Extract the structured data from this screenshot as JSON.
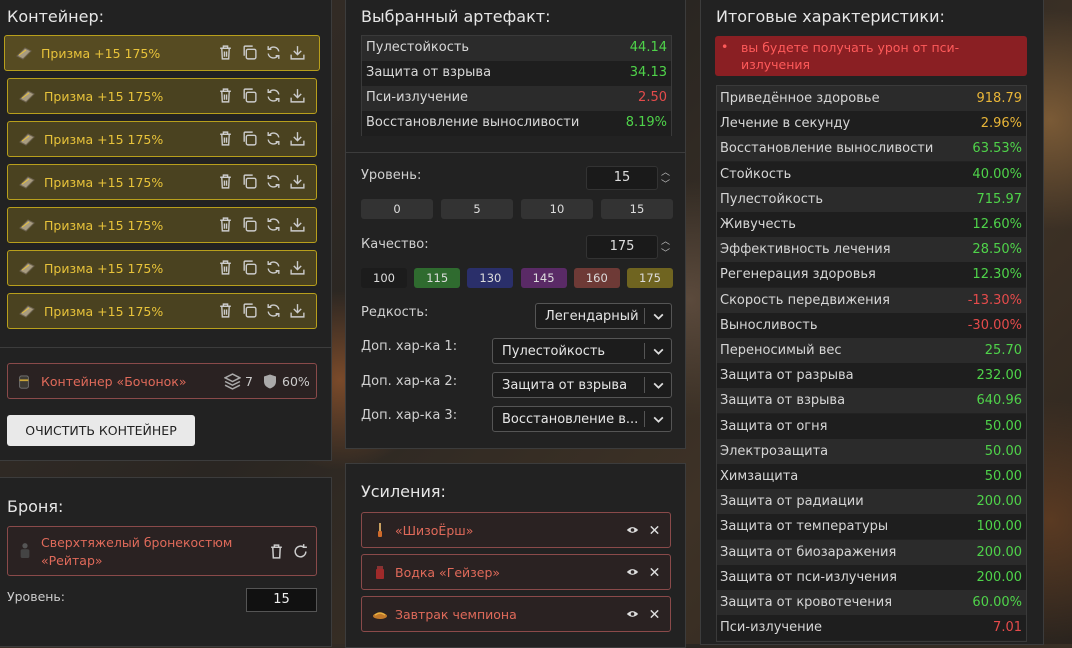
{
  "container": {
    "title": "Контейнер:",
    "slots": [
      {
        "label": "Призма +15 175%"
      },
      {
        "label": "Призма +15 175%"
      },
      {
        "label": "Призма +15 175%"
      },
      {
        "label": "Призма +15 175%"
      },
      {
        "label": "Призма +15 175%"
      },
      {
        "label": "Призма +15 175%"
      },
      {
        "label": "Призма +15 175%"
      }
    ],
    "barrel": {
      "name": "Контейнер «Бочонок»",
      "slots_count": "7",
      "protection": "60%"
    },
    "clear_label": "ОЧИСТИТЬ КОНТЕЙНЕР"
  },
  "armor": {
    "title": "Броня:",
    "name": "Сверхтяжелый бронекостюм «Рейтар»",
    "level_label": "Уровень:",
    "level_value": "15"
  },
  "artifact": {
    "title": "Выбранный артефакт:",
    "stats": [
      {
        "name": "Пулестойкость",
        "value": "44.14",
        "color": "#4fd34a"
      },
      {
        "name": "Защита от взрыва",
        "value": "34.13",
        "color": "#4fd34a"
      },
      {
        "name": "Пси-излучение",
        "value": "2.50",
        "color": "#e44b4b"
      },
      {
        "name": "Восстановление выносливости",
        "value": "8.19%",
        "color": "#4fd34a"
      }
    ],
    "level_label": "Уровень:",
    "level_value": "15",
    "level_presets": [
      "0",
      "5",
      "10",
      "15"
    ],
    "quality_label": "Качество:",
    "quality_value": "175",
    "quality_presets": [
      {
        "label": "100",
        "color": "#1c1c1c"
      },
      {
        "label": "115",
        "color": "#2f6b2f"
      },
      {
        "label": "130",
        "color": "#2a2f6a"
      },
      {
        "label": "145",
        "color": "#5a2a66"
      },
      {
        "label": "160",
        "color": "#6e3a36"
      },
      {
        "label": "175",
        "color": "#6f6420"
      }
    ],
    "rarity_label": "Редкость:",
    "rarity_value": "Легендарный",
    "extra1_label": "Доп. хар-ка 1:",
    "extra1_value": "Пулестойкость",
    "extra2_label": "Доп. хар-ка 2:",
    "extra2_value": "Защита от взрыва",
    "extra3_label": "Доп. хар-ка 3:",
    "extra3_value": "Восстановление в..."
  },
  "boosts": {
    "title": "Усиления:",
    "items": [
      {
        "name": "«ШизоЁрш»"
      },
      {
        "name": "Водка «Гейзер»"
      },
      {
        "name": "Завтрак чемпиона"
      }
    ]
  },
  "totals": {
    "title": "Итоговые характеристики:",
    "warning": "вы будете получать урон от пси-излучения",
    "stats": [
      {
        "name": "Приведённое здоровье",
        "value": "918.79",
        "color": "#e8b538"
      },
      {
        "name": "Лечение в секунду",
        "value": "2.96%",
        "color": "#e8b538"
      },
      {
        "name": "Восстановление выносливости",
        "value": "63.53%",
        "color": "#4fd34a"
      },
      {
        "name": "Стойкость",
        "value": "40.00%",
        "color": "#4fd34a"
      },
      {
        "name": "Пулестойкость",
        "value": "715.97",
        "color": "#4fd34a"
      },
      {
        "name": "Живучесть",
        "value": "12.60%",
        "color": "#4fd34a"
      },
      {
        "name": "Эффективность лечения",
        "value": "28.50%",
        "color": "#4fd34a"
      },
      {
        "name": "Регенерация здоровья",
        "value": "12.30%",
        "color": "#4fd34a"
      },
      {
        "name": "Скорость передвижения",
        "value": "-13.30%",
        "color": "#e44b4b"
      },
      {
        "name": "Выносливость",
        "value": "-30.00%",
        "color": "#e44b4b"
      },
      {
        "name": "Переносимый вес",
        "value": "25.70",
        "color": "#4fd34a"
      },
      {
        "name": "Защита от разрыва",
        "value": "232.00",
        "color": "#4fd34a"
      },
      {
        "name": "Защита от взрыва",
        "value": "640.96",
        "color": "#4fd34a"
      },
      {
        "name": "Защита от огня",
        "value": "50.00",
        "color": "#4fd34a"
      },
      {
        "name": "Электрозащита",
        "value": "50.00",
        "color": "#4fd34a"
      },
      {
        "name": "Химзащита",
        "value": "50.00",
        "color": "#4fd34a"
      },
      {
        "name": "Защита от радиации",
        "value": "200.00",
        "color": "#4fd34a"
      },
      {
        "name": "Защита от температуры",
        "value": "100.00",
        "color": "#4fd34a"
      },
      {
        "name": "Защита от биозаражения",
        "value": "200.00",
        "color": "#4fd34a"
      },
      {
        "name": "Защита от пси-излучения",
        "value": "200.00",
        "color": "#4fd34a"
      },
      {
        "name": "Защита от кровотечения",
        "value": "60.00%",
        "color": "#4fd34a"
      },
      {
        "name": "Пси-излучение",
        "value": "7.01",
        "color": "#e44b4b"
      }
    ]
  }
}
